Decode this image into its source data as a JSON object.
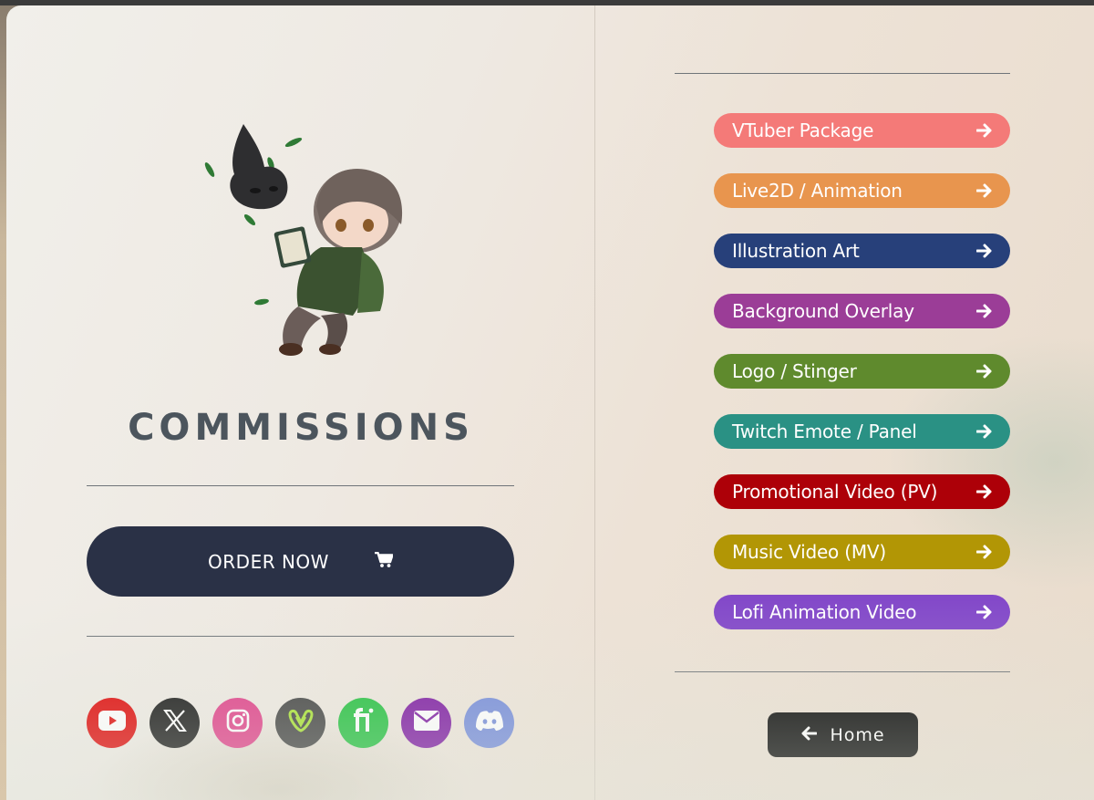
{
  "left": {
    "title": "COMMISSIONS",
    "order_button": {
      "label": "ORDER NOW",
      "icon": "shopping-cart-icon"
    },
    "socials": [
      {
        "name": "youtube",
        "color": "#e00000",
        "icon": "youtube-icon"
      },
      {
        "name": "x",
        "color": "#111111",
        "icon": "x-logo-icon"
      },
      {
        "name": "instagram",
        "color": "#df3a86",
        "icon": "instagram-icon"
      },
      {
        "name": "vgen",
        "color": "#3d3d3d",
        "icon": "vgen-icon"
      },
      {
        "name": "fiverr",
        "color": "#1dbf3a",
        "icon": "fiverr-icon"
      },
      {
        "name": "email",
        "color": "#7a13a0",
        "icon": "envelope-icon"
      },
      {
        "name": "discord",
        "color": "#7289da",
        "icon": "discord-icon"
      }
    ]
  },
  "right": {
    "links": [
      {
        "label": "VTuber Package",
        "color": "#f47a78"
      },
      {
        "label": "Live2D / Animation",
        "color": "#e8954e"
      },
      {
        "label": "Illustration Art",
        "color": "#27407a"
      },
      {
        "label": "Background Overlay",
        "color": "#9b3d97"
      },
      {
        "label": "Logo / Stinger",
        "color": "#5f8a2d"
      },
      {
        "label": "Twitch Emote / Panel",
        "color": "#2a9184"
      },
      {
        "label": "Promotional Video (PV)",
        "color": "#ad0008"
      },
      {
        "label": "Music Video (MV)",
        "color": "#b29605"
      },
      {
        "label": "Lofi Animation Video",
        "color": "#8349c9"
      }
    ],
    "link_icon": "arrow-right-icon",
    "home_button": {
      "label": "Home",
      "icon": "arrow-left-icon"
    }
  }
}
